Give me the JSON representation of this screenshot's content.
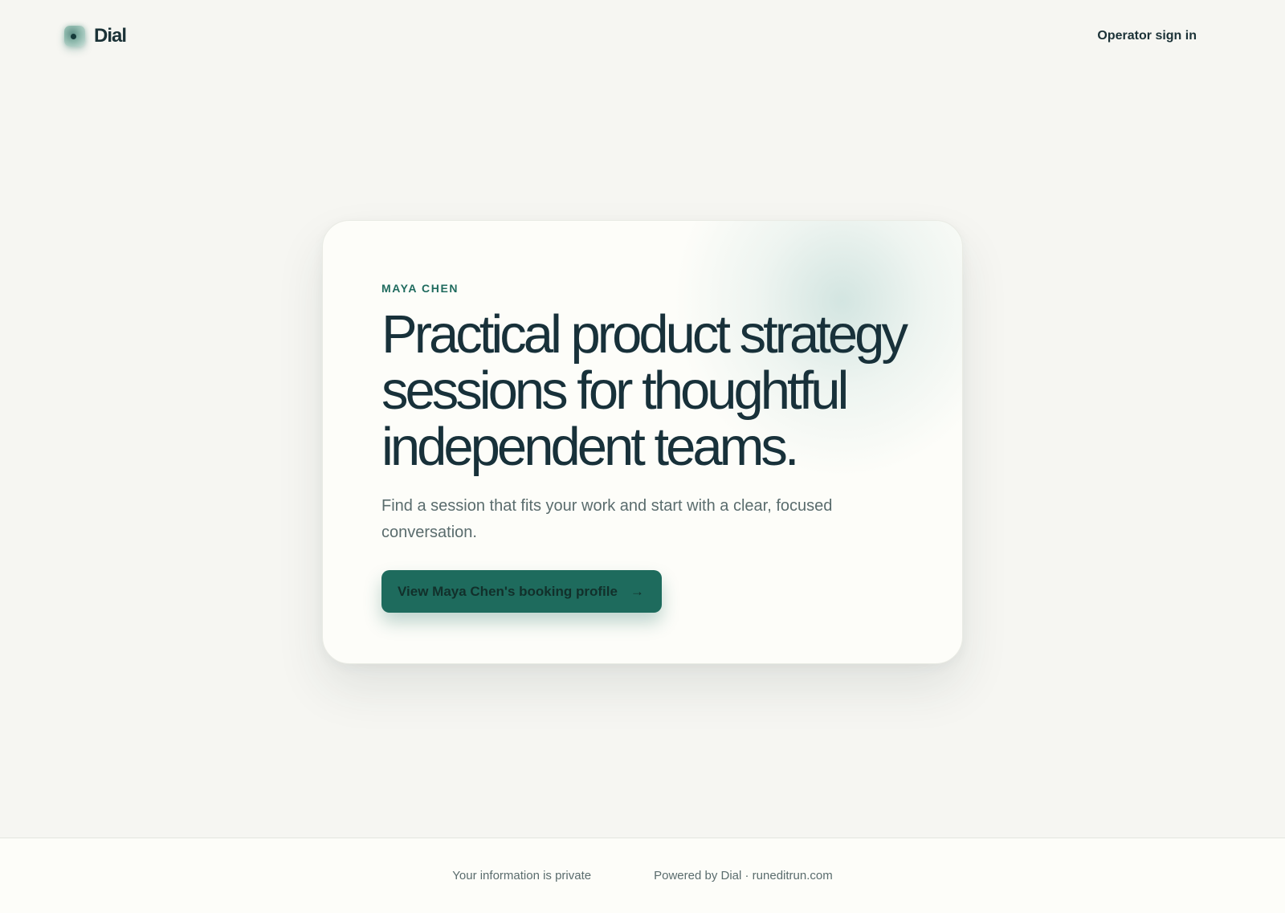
{
  "header": {
    "brand_name": "Dial",
    "signin_label": "Operator sign in"
  },
  "hero": {
    "eyebrow": "MAYA CHEN",
    "headline": "Practical product strategy sessions for thoughtful independent teams.",
    "subtext": "Find a session that fits your work and start with a clear, focused conversation.",
    "cta_label": "View Maya Chen's booking profile",
    "cta_icon": "arrow-right-icon"
  },
  "footer": {
    "privacy_text": "Your information is private",
    "powered_text": "Powered by Dial · runeditrun.com"
  },
  "colors": {
    "background": "#f6f6f2",
    "card": "#fdfdf9",
    "accent": "#1e6b5d",
    "heading": "#18313a",
    "muted": "#5a6c6d"
  }
}
